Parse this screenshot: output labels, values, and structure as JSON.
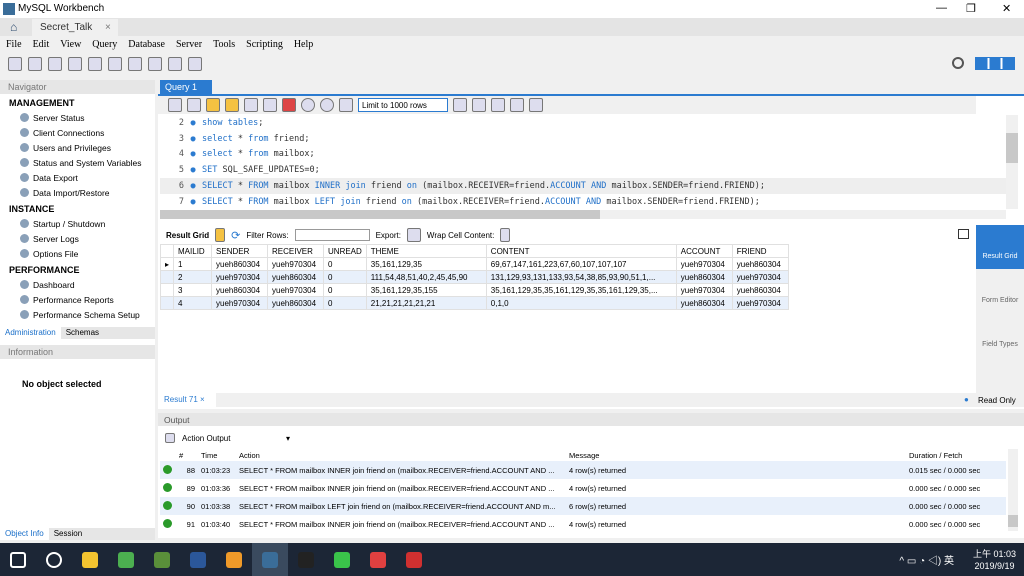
{
  "window": {
    "title": "MySQL Workbench",
    "controls": [
      "—",
      "❐",
      "✕"
    ]
  },
  "conn_tab": {
    "label": "Secret_Talk",
    "close": "×"
  },
  "menu": [
    "File",
    "Edit",
    "View",
    "Query",
    "Database",
    "Server",
    "Tools",
    "Scripting",
    "Help"
  ],
  "sidebar": {
    "header": "Navigator",
    "management": {
      "title": "MANAGEMENT",
      "items": [
        "Server Status",
        "Client Connections",
        "Users and Privileges",
        "Status and System Variables",
        "Data Export",
        "Data Import/Restore"
      ]
    },
    "instance": {
      "title": "INSTANCE",
      "items": [
        "Startup / Shutdown",
        "Server Logs",
        "Options File"
      ]
    },
    "performance": {
      "title": "PERFORMANCE",
      "items": [
        "Dashboard",
        "Performance Reports",
        "Performance Schema Setup"
      ]
    },
    "tabs": [
      "Administration",
      "Schemas"
    ],
    "info_header": "Information",
    "info_text": "No object selected",
    "bottom_tabs": [
      "Object Info",
      "Session"
    ]
  },
  "query_tab": {
    "label": "Query 1",
    "close": "×"
  },
  "editor_toolbar": {
    "limit": "Limit to 1000 rows"
  },
  "editor": {
    "lines": [
      {
        "n": "2",
        "code": [
          [
            "kw",
            "show tables"
          ],
          [
            "c",
            ";"
          ]
        ]
      },
      {
        "n": "3",
        "code": [
          [
            "kw",
            "select"
          ],
          [
            "c",
            " * "
          ],
          [
            "kw",
            "from"
          ],
          [
            "c",
            " friend;"
          ]
        ]
      },
      {
        "n": "4",
        "code": [
          [
            "kw",
            "select"
          ],
          [
            "c",
            " * "
          ],
          [
            "kw",
            "from"
          ],
          [
            "c",
            " mailbox;"
          ]
        ]
      },
      {
        "n": "5",
        "code": [
          [
            "kw",
            "SET"
          ],
          [
            "c",
            " SQL_SAFE_UPDATES=0;"
          ]
        ]
      },
      {
        "n": "6",
        "code": [
          [
            "kw",
            "SELECT"
          ],
          [
            "c",
            " * "
          ],
          [
            "kw",
            "FROM"
          ],
          [
            "c",
            " mailbox "
          ],
          [
            "kw",
            "INNER join"
          ],
          [
            "c",
            " friend "
          ],
          [
            "kw",
            "on"
          ],
          [
            "c",
            " (mailbox.RECEIVER=friend."
          ],
          [
            "kw",
            "ACCOUNT AND"
          ],
          [
            "c",
            " mailbox.SENDER=friend.FRIEND);"
          ]
        ]
      },
      {
        "n": "7",
        "code": [
          [
            "kw",
            "SELECT"
          ],
          [
            "c",
            " * "
          ],
          [
            "kw",
            "FROM"
          ],
          [
            "c",
            " mailbox "
          ],
          [
            "kw",
            "LEFT join"
          ],
          [
            "c",
            " friend "
          ],
          [
            "kw",
            "on"
          ],
          [
            "c",
            " (mailbox.RECEIVER=friend."
          ],
          [
            "kw",
            "ACCOUNT AND"
          ],
          [
            "c",
            " mailbox.SENDER=friend.FRIEND);"
          ]
        ]
      }
    ]
  },
  "result_toolbar": {
    "grid_label": "Result Grid",
    "filter_label": "Filter Rows:",
    "export_label": "Export:",
    "wrap_label": "Wrap Cell Content:"
  },
  "result_grid": {
    "columns": [
      "MAILID",
      "SENDER",
      "RECEIVER",
      "UNREAD",
      "THEME",
      "CONTENT",
      "ACCOUNT",
      "FRIEND"
    ],
    "rows": [
      [
        "1",
        "yueh860304",
        "yueh970304",
        "0",
        "35,161,129,35",
        "69,67,147,161,223,67,60,107,107,107",
        "yueh970304",
        "yueh860304"
      ],
      [
        "2",
        "yueh970304",
        "yueh860304",
        "0",
        "111,54,48,51,40,2,45,45,90",
        "131,129,93,131,133,93,54,38,85,93,90,51,1,...",
        "yueh860304",
        "yueh970304"
      ],
      [
        "3",
        "yueh860304",
        "yueh970304",
        "0",
        "35,161,129,35,155",
        "35,161,129,35,35,161,129,35,35,161,129,35,...",
        "yueh970304",
        "yueh860304"
      ],
      [
        "4",
        "yueh970304",
        "yueh860304",
        "0",
        "21,21,21,21,21,21",
        "0,1,0",
        "yueh860304",
        "yueh970304"
      ]
    ]
  },
  "right_panel": [
    "Result Grid",
    "Form Editor",
    "Field Types"
  ],
  "result_tab": {
    "label": "Result 71",
    "close": "×",
    "status": "Read Only"
  },
  "output": {
    "header": "Output",
    "selector": "Action Output",
    "columns": [
      "",
      "#",
      "Time",
      "Action",
      "Message",
      "Duration / Fetch"
    ],
    "rows": [
      [
        "88",
        "01:03:23",
        "SELECT * FROM mailbox INNER join friend on (mailbox.RECEIVER=friend.ACCOUNT AND ...",
        "4 row(s) returned",
        "0.015 sec / 0.000 sec"
      ],
      [
        "89",
        "01:03:36",
        "SELECT * FROM mailbox INNER join friend on (mailbox.RECEIVER=friend.ACCOUNT AND ...",
        "4 row(s) returned",
        "0.000 sec / 0.000 sec"
      ],
      [
        "90",
        "01:03:38",
        "SELECT * FROM mailbox LEFT join friend on (mailbox.RECEIVER=friend.ACCOUNT AND m...",
        "6 row(s) returned",
        "0.000 sec / 0.000 sec"
      ],
      [
        "91",
        "01:03:40",
        "SELECT * FROM mailbox INNER join friend on (mailbox.RECEIVER=friend.ACCOUNT AND ...",
        "4 row(s) returned",
        "0.000 sec / 0.000 sec"
      ]
    ]
  },
  "taskbar": {
    "apps": [
      "start",
      "search",
      "file-explorer",
      "chrome",
      "spreadsheet",
      "word",
      "sublime",
      "mysql-workbench",
      "terminal",
      "line",
      "chat",
      "recorder"
    ],
    "app_colors": [
      "#ffffff",
      "#ffffff",
      "#f4c430",
      "#4caf50",
      "#5a8f3a",
      "#2b579a",
      "#f09a29",
      "#3a6d99",
      "#222222",
      "#3ac34a",
      "#e04040",
      "#d03030"
    ],
    "ime": "英",
    "time": "上午 01:03",
    "date": "2019/9/19"
  },
  "colors": {
    "accent": "#2b7bd0",
    "row_alt": "#e8f0fb",
    "taskbar": "#1c2636"
  }
}
